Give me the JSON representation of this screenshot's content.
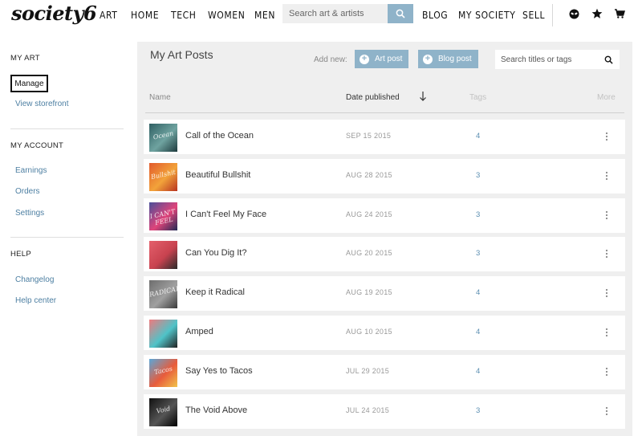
{
  "brand": {
    "logo": "society6"
  },
  "nav": {
    "items": [
      {
        "label": "ART",
        "name": "nav-art"
      },
      {
        "label": "HOME",
        "name": "nav-home"
      },
      {
        "label": "TECH",
        "name": "nav-tech"
      },
      {
        "label": "WOMEN",
        "name": "nav-women"
      },
      {
        "label": "MEN",
        "name": "nav-men"
      }
    ],
    "search_placeholder": "Search art & artists",
    "right_items": [
      {
        "label": "BLOG",
        "name": "nav-blog"
      },
      {
        "label": "MY SOCIETY",
        "name": "nav-my-society"
      },
      {
        "label": "SELL",
        "name": "nav-sell"
      }
    ],
    "icons": [
      "alien-icon",
      "star-icon",
      "cart-icon"
    ]
  },
  "sidebar": {
    "sections": [
      {
        "heading": "MY ART",
        "links": [
          "Manage",
          "View storefront"
        ]
      },
      {
        "heading": "MY ACCOUNT",
        "links": [
          "Earnings",
          "Orders",
          "Settings"
        ]
      },
      {
        "heading": "HELP",
        "links": [
          "Changelog",
          "Help center"
        ]
      }
    ]
  },
  "main": {
    "title": "My Art Posts",
    "add_new_label": "Add new:",
    "art_post_label": "Art post",
    "blog_post_label": "Blog post",
    "search_placeholder": "Search titles or tags",
    "columns": {
      "name": "Name",
      "date": "Date published",
      "tags": "Tags",
      "more": "More"
    },
    "rows": [
      {
        "name": "Call of the Ocean",
        "date": "SEP 15 2015",
        "tags": "4",
        "thumb_text": "Ocean",
        "thumb_colors": [
          "#2f5f63",
          "#6fa3a0",
          "#1d3a3d"
        ]
      },
      {
        "name": "Beautiful Bullshit",
        "date": "AUG 28 2015",
        "tags": "3",
        "thumb_text": "Bullshit",
        "thumb_colors": [
          "#e25a2c",
          "#f2a33a",
          "#b83421"
        ]
      },
      {
        "name": "I Can't Feel My Face",
        "date": "AUG 24 2015",
        "tags": "3",
        "thumb_text": "I CAN'T FEEL",
        "thumb_colors": [
          "#4a4f9a",
          "#e0447a",
          "#222a55"
        ]
      },
      {
        "name": "Can You Dig It?",
        "date": "AUG 20 2015",
        "tags": "3",
        "thumb_text": "",
        "thumb_colors": [
          "#e4606c",
          "#c8424f",
          "#2a2a2a"
        ]
      },
      {
        "name": "Keep it Radical",
        "date": "AUG 19 2015",
        "tags": "4",
        "thumb_text": "RADICAL",
        "thumb_colors": [
          "#6d6d6d",
          "#a0a0a0",
          "#3a3a3a"
        ]
      },
      {
        "name": "Amped",
        "date": "AUG 10 2015",
        "tags": "4",
        "thumb_text": "",
        "thumb_colors": [
          "#f07a7e",
          "#4fc3c8",
          "#222"
        ]
      },
      {
        "name": "Say Yes to Tacos",
        "date": "JUL 29 2015",
        "tags": "4",
        "thumb_text": "Tacos",
        "thumb_colors": [
          "#5aa7d8",
          "#e85b3c",
          "#f1c34a"
        ]
      },
      {
        "name": "The Void Above",
        "date": "JUL 24 2015",
        "tags": "3",
        "thumb_text": "Void",
        "thumb_colors": [
          "#111",
          "#555",
          "#000"
        ]
      }
    ]
  },
  "colors": {
    "accent": "#8fb3c9",
    "link": "#4d7fa2",
    "panel_bg": "#efefef"
  }
}
